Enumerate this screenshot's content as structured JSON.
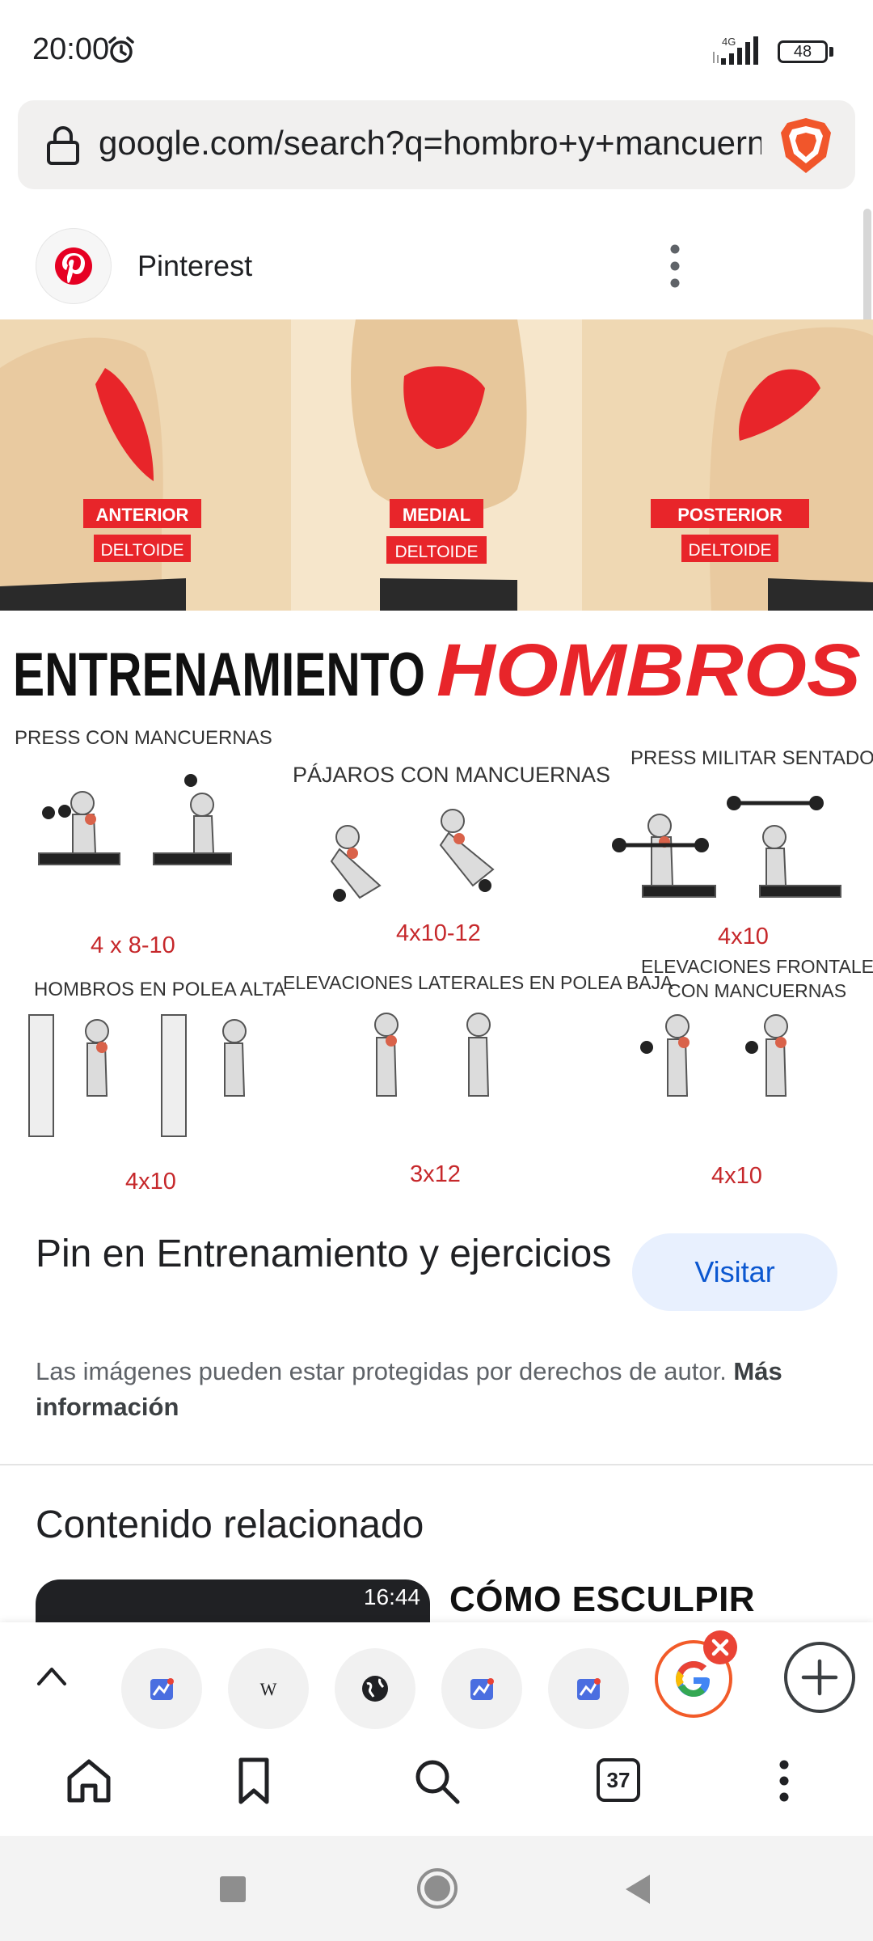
{
  "status_bar": {
    "time": "20:00",
    "network": "4G",
    "battery": "48"
  },
  "browser": {
    "url": "google.com/search?q=hombro+y+mancuernas"
  },
  "result": {
    "source_name": "Pinterest",
    "title": "Pin en Entrenamiento y ejercicios",
    "visit_label": "Visitar",
    "copyright_text": "Las imágenes pueden estar protegidas por derechos de autor. ",
    "copyright_link": "Más información"
  },
  "infographic": {
    "deltoids": [
      {
        "part": "ANTERIOR",
        "word": "DELTOIDE"
      },
      {
        "part": "MEDIAL",
        "word": "DELTOIDE"
      },
      {
        "part": "POSTERIOR",
        "word": "DELTOIDE"
      }
    ],
    "heading_left": "ENTRENAMIENTO",
    "heading_right": "HOMBROS",
    "exercises": [
      {
        "name": "PRESS CON MANCUERNAS",
        "sets": "4 x 8-10"
      },
      {
        "name": "PÁJAROS CON MANCUERNAS",
        "sets": "4x10-12"
      },
      {
        "name": "PRESS MILITAR SENTADO",
        "sets": "4x10"
      },
      {
        "name": "HOMBROS EN POLEA ALTA",
        "sets": "4x10"
      },
      {
        "name": "ELEVACIONES LATERALES EN POLEA BAJA",
        "sets": "3x12"
      },
      {
        "name_line1": "ELEVACIONES FRONTALES",
        "name_line2": "CON MANCUERNAS",
        "sets": "4x10"
      }
    ]
  },
  "related": {
    "heading": "Contenido relacionado",
    "card1_time": "16:44",
    "card2_text": "CÓMO ESCULPIR TUS"
  },
  "tab_strip": {
    "wiki_glyph": "W"
  },
  "bottom_nav": {
    "tabs_count": "37"
  },
  "colors": {
    "accent": "#f25b29",
    "visit_bg": "#e8f0fe",
    "visit_text": "#0b57d0",
    "red": "#e8252a"
  }
}
